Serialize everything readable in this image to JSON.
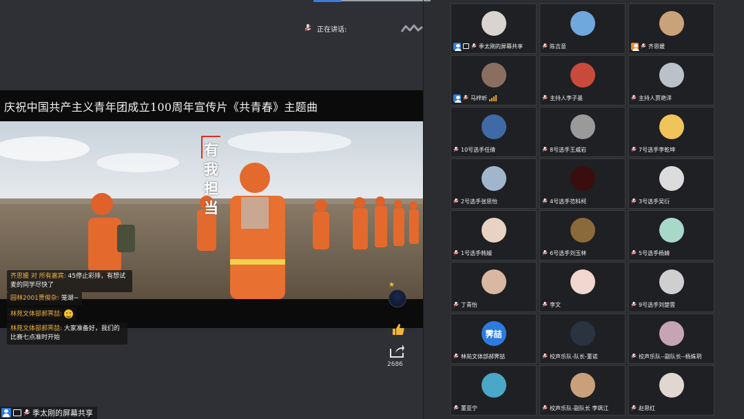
{
  "speaking": {
    "label": "正在讲话:"
  },
  "video": {
    "title": "庆祝中国共产主义青年团成立100周年宣传片《共青春》主题曲",
    "overlay_text": "有我担当"
  },
  "comments": [
    {
      "name": "齐思媛 对 所有嘉宾:",
      "text": " 45停止彩排，有想试麦的同学尽快了"
    },
    {
      "name": "园林2001贾俊杂:",
      "text": " 笼湖~"
    },
    {
      "name": "林苑文体部郝霁喆:",
      "text": "",
      "emoji": "smile-emoji"
    },
    {
      "name": "林苑文体部郝霁喆:",
      "text": " 大家准备好，我们的比赛七点准时开始"
    }
  ],
  "reactions": {
    "like_count": "2686"
  },
  "screen_share_label": "季太刚的屏幕共享",
  "participants": [
    {
      "name": "季太刚的屏幕共享",
      "role_icon": "user-blue-icon",
      "screen_icon": true,
      "avatar": "#d9d4d0",
      "signal": false
    },
    {
      "name": "陈吉意",
      "avatar": "#6fa8dc",
      "signal": false
    },
    {
      "name": "齐思媛",
      "role_icon": "user-orange-icon",
      "avatar": "#caa27a",
      "signal": false
    },
    {
      "name": "马梓昕",
      "role_icon": "user-blue-icon",
      "avatar": "#8a6f60",
      "signal": true
    },
    {
      "name": "主持人李子墨",
      "avatar": "#c94a3b",
      "signal": false
    },
    {
      "name": "主持人贾艳洋",
      "avatar": "#b9c2c8",
      "signal": false
    },
    {
      "name": "10号选手任倩",
      "avatar": "#3f6aa6",
      "signal": false
    },
    {
      "name": "8号选手王威岩",
      "avatar": "#9a9a9a",
      "signal": false
    },
    {
      "name": "7号选手李乾坤",
      "avatar": "#f0c45a",
      "signal": false
    },
    {
      "name": "2号选手张思怡",
      "avatar": "#9fb6cc",
      "signal": false
    },
    {
      "name": "4号选手范科柯",
      "avatar": "#3a0e0e",
      "signal": false
    },
    {
      "name": "3号选手吴衍",
      "avatar": "#dcdcdc",
      "signal": false
    },
    {
      "name": "1号选手韩嫚",
      "avatar": "#e8d2c2",
      "signal": false
    },
    {
      "name": "6号选手刘玉林",
      "avatar": "#8a6a3a",
      "signal": false
    },
    {
      "name": "5号选手杨婧",
      "avatar": "#a8d8c8",
      "signal": false
    },
    {
      "name": "丁青怡",
      "avatar": "#d8b8a0",
      "signal": false
    },
    {
      "name": "李文",
      "avatar": "#f1d7cf",
      "signal": false
    },
    {
      "name": "9号选手刘楚雲",
      "avatar": "#cfcfcf",
      "signal": false
    },
    {
      "name": "林苑文体部郝霁喆",
      "avatar": "#2d7be0",
      "avatar_text": "霁喆",
      "signal": false
    },
    {
      "name": "校声乐队-队长-董诺",
      "avatar": "#2a3440",
      "signal": false
    },
    {
      "name": "校声乐队--副队长--杨姝玥",
      "avatar": "#c7a4b4",
      "signal": false
    },
    {
      "name": "董亚宁",
      "avatar": "#4aa7c8",
      "signal": false
    },
    {
      "name": "校声乐队-副队长 李飒江",
      "avatar": "#c9a07a",
      "signal": false
    },
    {
      "name": "赵思红",
      "avatar": "#e0d8d0",
      "signal": false
    }
  ]
}
